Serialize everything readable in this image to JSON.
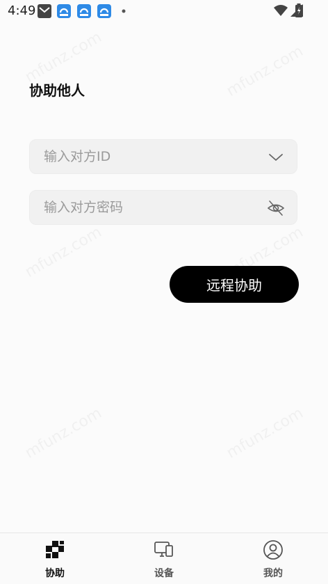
{
  "status_bar": {
    "time": "4:49"
  },
  "watermark": "mfunz.com",
  "page": {
    "title": "协助他人"
  },
  "form": {
    "partner_id_placeholder": "输入对方ID",
    "partner_password_placeholder": "输入对方密码",
    "submit_label": "远程协助"
  },
  "tabs": [
    {
      "label": "协助",
      "icon": "assist-icon",
      "active": true
    },
    {
      "label": "设备",
      "icon": "devices-icon",
      "active": false
    },
    {
      "label": "我的",
      "icon": "profile-icon",
      "active": false
    }
  ],
  "colors": {
    "active_tab": "#111111",
    "inactive_tab": "#555555",
    "button_bg": "#000000",
    "field_bg": "#f1f1f1"
  }
}
